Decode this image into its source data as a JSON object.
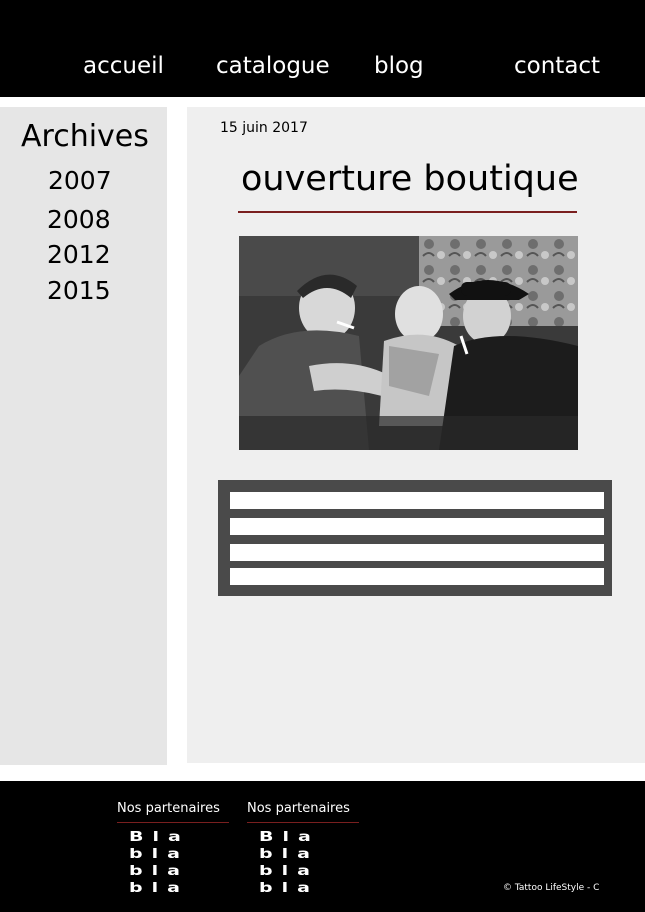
{
  "nav": {
    "items": [
      "accueil",
      "catalogue",
      "blog",
      "contact"
    ]
  },
  "sidebar": {
    "title": "Archives",
    "years": [
      "2007",
      "2008",
      "2012",
      "2015"
    ]
  },
  "post": {
    "date": "15 juin 2017",
    "title": "ouverture boutique",
    "image_alt_icon": "tattoo-photo"
  },
  "footer": {
    "partners": [
      {
        "title": "Nos partenaires",
        "lines": [
          "Bla",
          "bla",
          "bla",
          "bla"
        ]
      },
      {
        "title": "Nos partenaires",
        "lines": [
          "Bla",
          "bla",
          "bla",
          "bla"
        ]
      }
    ],
    "copyright": "© Tattoo LifeStyle - C"
  },
  "colors": {
    "header_bg": "#000000",
    "sidebar_bg": "#e6e6e6",
    "main_bg": "#efefef",
    "accent_rule": "#7a1f1f",
    "text_block_bg": "#4a4a4a"
  }
}
